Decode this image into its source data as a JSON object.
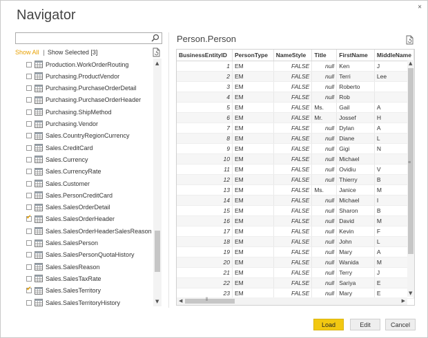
{
  "window": {
    "title": "Navigator",
    "close_glyph": "×"
  },
  "search": {
    "value": "",
    "placeholder": ""
  },
  "filters": {
    "show_all": "Show All",
    "separator": "|",
    "show_selected": "Show Selected [3]"
  },
  "tree": {
    "items": [
      {
        "label": "Production.WorkOrderRouting",
        "checked": false
      },
      {
        "label": "Purchasing.ProductVendor",
        "checked": false
      },
      {
        "label": "Purchasing.PurchaseOrderDetail",
        "checked": false
      },
      {
        "label": "Purchasing.PurchaseOrderHeader",
        "checked": false
      },
      {
        "label": "Purchasing.ShipMethod",
        "checked": false
      },
      {
        "label": "Purchasing.Vendor",
        "checked": false
      },
      {
        "label": "Sales.CountryRegionCurrency",
        "checked": false
      },
      {
        "label": "Sales.CreditCard",
        "checked": false
      },
      {
        "label": "Sales.Currency",
        "checked": false
      },
      {
        "label": "Sales.CurrencyRate",
        "checked": false
      },
      {
        "label": "Sales.Customer",
        "checked": false
      },
      {
        "label": "Sales.PersonCreditCard",
        "checked": false
      },
      {
        "label": "Sales.SalesOrderDetail",
        "checked": false
      },
      {
        "label": "Sales.SalesOrderHeader",
        "checked": true
      },
      {
        "label": "Sales.SalesOrderHeaderSalesReason",
        "checked": false
      },
      {
        "label": "Sales.SalesPerson",
        "checked": false
      },
      {
        "label": "Sales.SalesPersonQuotaHistory",
        "checked": false
      },
      {
        "label": "Sales.SalesReason",
        "checked": false
      },
      {
        "label": "Sales.SalesTaxRate",
        "checked": false
      },
      {
        "label": "Sales.SalesTerritory",
        "checked": true
      },
      {
        "label": "Sales.SalesTerritoryHistory",
        "checked": false
      }
    ]
  },
  "preview": {
    "title": "Person.Person",
    "columns": [
      "BusinessEntityID",
      "PersonType",
      "NameStyle",
      "Title",
      "FirstName",
      "MiddleName"
    ],
    "rows": [
      [
        "1",
        "EM",
        "FALSE",
        "null",
        "Ken",
        "J"
      ],
      [
        "2",
        "EM",
        "FALSE",
        "null",
        "Terri",
        "Lee"
      ],
      [
        "3",
        "EM",
        "FALSE",
        "null",
        "Roberto",
        ""
      ],
      [
        "4",
        "EM",
        "FALSE",
        "null",
        "Rob",
        ""
      ],
      [
        "5",
        "EM",
        "FALSE",
        "Ms.",
        "Gail",
        "A"
      ],
      [
        "6",
        "EM",
        "FALSE",
        "Mr.",
        "Jossef",
        "H"
      ],
      [
        "7",
        "EM",
        "FALSE",
        "null",
        "Dylan",
        "A"
      ],
      [
        "8",
        "EM",
        "FALSE",
        "null",
        "Diane",
        "L"
      ],
      [
        "9",
        "EM",
        "FALSE",
        "null",
        "Gigi",
        "N"
      ],
      [
        "10",
        "EM",
        "FALSE",
        "null",
        "Michael",
        ""
      ],
      [
        "11",
        "EM",
        "FALSE",
        "null",
        "Ovidiu",
        "V"
      ],
      [
        "12",
        "EM",
        "FALSE",
        "null",
        "Thierry",
        "B"
      ],
      [
        "13",
        "EM",
        "FALSE",
        "Ms.",
        "Janice",
        "M"
      ],
      [
        "14",
        "EM",
        "FALSE",
        "null",
        "Michael",
        "I"
      ],
      [
        "15",
        "EM",
        "FALSE",
        "null",
        "Sharon",
        "B"
      ],
      [
        "16",
        "EM",
        "FALSE",
        "null",
        "David",
        "M"
      ],
      [
        "17",
        "EM",
        "FALSE",
        "null",
        "Kevin",
        "F"
      ],
      [
        "18",
        "EM",
        "FALSE",
        "null",
        "John",
        "L"
      ],
      [
        "19",
        "EM",
        "FALSE",
        "null",
        "Mary",
        "A"
      ],
      [
        "20",
        "EM",
        "FALSE",
        "null",
        "Wanida",
        "M"
      ],
      [
        "21",
        "EM",
        "FALSE",
        "null",
        "Terry",
        "J"
      ],
      [
        "22",
        "EM",
        "FALSE",
        "null",
        "Sariya",
        "E"
      ],
      [
        "23",
        "EM",
        "FALSE",
        "null",
        "Mary",
        "E"
      ]
    ]
  },
  "buttons": {
    "load": "Load",
    "edit": "Edit",
    "cancel": "Cancel"
  },
  "colors": {
    "accent": "#e8a000",
    "load_button": "#f2c811"
  }
}
